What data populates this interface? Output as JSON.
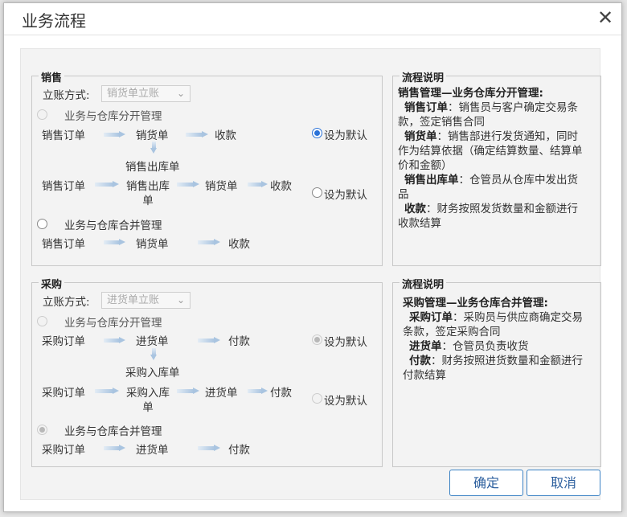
{
  "window": {
    "title": "业务流程",
    "close": "✕"
  },
  "sales": {
    "legend": "销售",
    "mode_label": "立账方式:",
    "mode_value": "销货单立账",
    "option_separate": "业务与仓库分开管理",
    "option_merged": "业务与仓库合并管理",
    "set_default_1": "设为默认",
    "set_default_2": "设为默认",
    "flow1": [
      "销售订单",
      "销货单",
      "收款"
    ],
    "outbound_label": "销售出库单",
    "flow2": [
      "销售订单",
      "销售出库",
      "单",
      "销货单",
      "收款"
    ],
    "flow3": [
      "销售订单",
      "销货单",
      "收款"
    ],
    "default_selected": 1
  },
  "sales_desc": {
    "legend": "流程说明",
    "heading": "销售管理—业务仓库分开管理:",
    "items": [
      {
        "term": "销售订单",
        "lines": [
          "：销售员与客户确定交易条",
          "款，签定销售合同"
        ]
      },
      {
        "term": "销货单",
        "lines": [
          "：销售部进行发货通知，同时",
          "作为结算依据（确定结算数量、结算单",
          "价和金额）"
        ]
      },
      {
        "term": "销售出库单",
        "lines": [
          "：仓管员从仓库中发出货",
          "品"
        ]
      },
      {
        "term": "收款",
        "lines": [
          "：财务按照发货数量和金额进行",
          "收款结算"
        ]
      }
    ]
  },
  "purchase": {
    "legend": "采购",
    "mode_label": "立账方式:",
    "mode_value": "进货单立账",
    "option_separate": "业务与仓库分开管理",
    "option_merged": "业务与仓库合并管理",
    "set_default_1": "设为默认",
    "set_default_2": "设为默认",
    "flow1": [
      "采购订单",
      "进货单",
      "付款"
    ],
    "inbound_label": "采购入库单",
    "flow2": [
      "采购订单",
      "采购入库",
      "单",
      "进货单",
      "付款"
    ],
    "flow3": [
      "采购订单",
      "进货单",
      "付款"
    ]
  },
  "purchase_desc": {
    "legend": "流程说明",
    "heading": "采购管理—业务仓库合并管理:",
    "items": [
      {
        "term": "采购订单",
        "lines": [
          "：采购员与供应商确定交易",
          "条款，签定采购合同"
        ]
      },
      {
        "term": "进货单",
        "lines": [
          "：仓管员负责收货"
        ]
      },
      {
        "term": "付款",
        "lines": [
          "：财务按照进货数量和金额进行",
          "付款结算"
        ]
      }
    ]
  },
  "buttons": {
    "ok": "确定",
    "cancel": "取消"
  }
}
